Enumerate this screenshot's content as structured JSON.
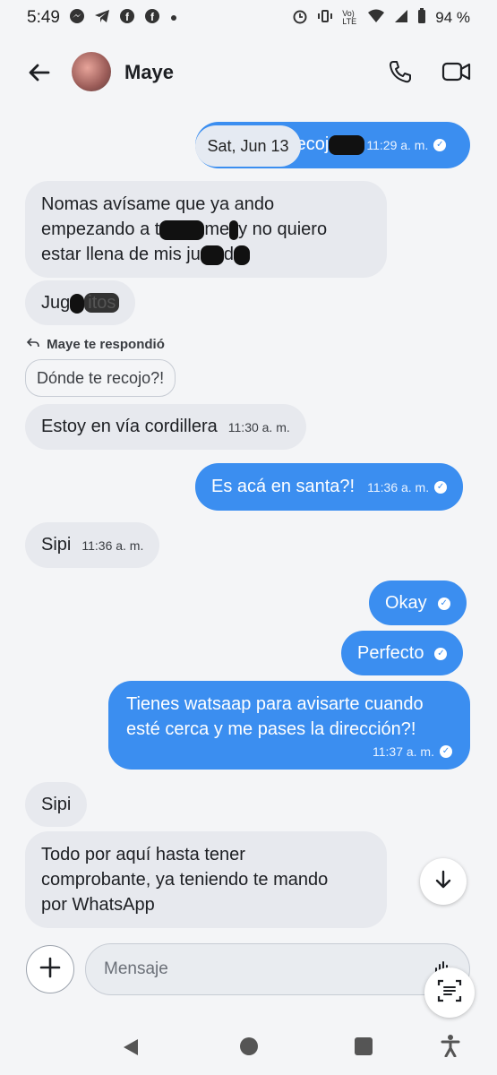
{
  "status_bar": {
    "time": "5:49",
    "battery": "94 %",
    "network_label": "Vo) LTE",
    "icons": [
      "messenger-icon",
      "telegram-icon",
      "facebook-icon",
      "facebook-icon",
      "dot-icon",
      "alarm-icon",
      "vibrate-icon",
      "wifi-icon",
      "signal-icon",
      "battery-icon"
    ]
  },
  "header": {
    "contact_name": "Maye",
    "icons": [
      "back-arrow-icon",
      "phone-icon",
      "video-camera-icon"
    ]
  },
  "messages": {
    "date_chip": "Sat, Jun 13",
    "m1_partial": "recoj",
    "m1_time": "11:29 a. m.",
    "m2_line1": "Nomas avísame que ya ando",
    "m2_line2_a": "empezando a t",
    "m2_line2_b": "me",
    "m2_line2_c": "y no quiero",
    "m2_line3_a": "estar llena de mis ju",
    "m2_line3_b": "d",
    "m3_a": "Jug",
    "m3_b": "itos",
    "reply_note": "Maye te respondió",
    "quoted_text": "Dónde te recojo?!",
    "m4_text": "Estoy en vía cordillera",
    "m4_time": "11:30 a. m.",
    "m5_text": "Es acá en santa?!",
    "m5_time": "11:36 a. m.",
    "m6_text": "Sipi",
    "m6_time": "11:36 a. m.",
    "m7_text": "Okay",
    "m8_text": "Perfecto",
    "m9_line1": "Tienes watsaap para avisarte cuando",
    "m9_line2": "esté cerca y me pases la dirección?!",
    "m9_time": "11:37 a. m.",
    "m10_text": "Sipi",
    "m11_line1": "Todo por aquí hasta tener",
    "m11_line2": "comprobante, ya teniendo te mando",
    "m11_line3": "por WhatsApp"
  },
  "composer": {
    "placeholder": "Mensaje"
  },
  "colors": {
    "outgoing": "#3b8ef0",
    "incoming": "#e7e9ee",
    "background": "#f4f5f7"
  }
}
